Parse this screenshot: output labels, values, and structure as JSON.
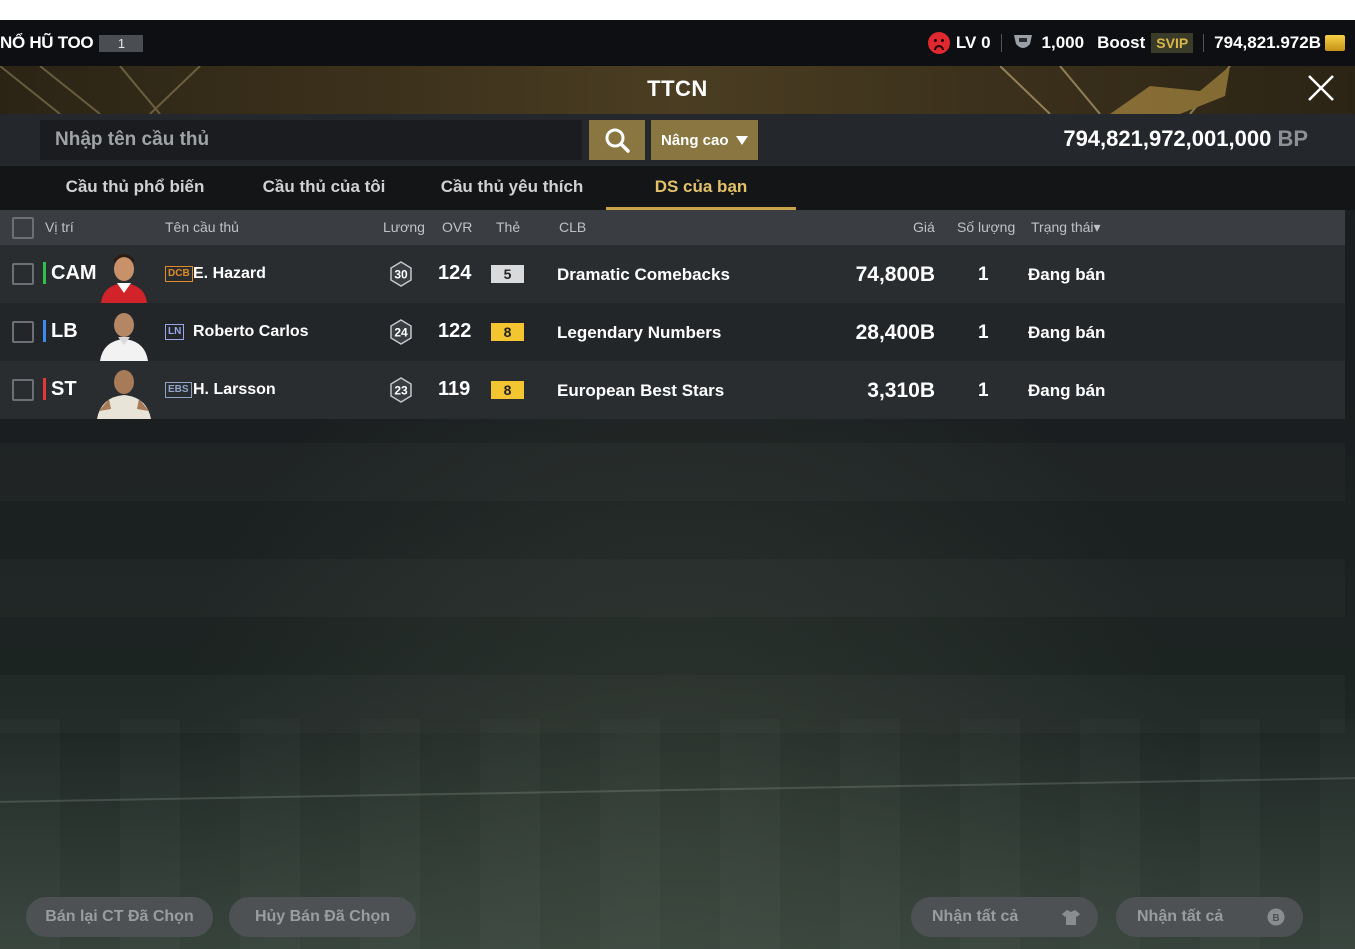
{
  "topbar": {
    "event_label": "NỔ HŨ TOO",
    "event_count": "1",
    "level": "LV 0",
    "trophy_value": "1,000",
    "boost_label": "Boost",
    "svip_label": "SVIP",
    "currency_value": "794,821.972B"
  },
  "header": {
    "title": "TTCN"
  },
  "search": {
    "placeholder": "Nhập tên cầu thủ",
    "advanced_label": "Nâng cao",
    "bp_amount": "794,821,972,001,000",
    "bp_unit": "BP"
  },
  "tabs": [
    {
      "label": "Cầu thủ phổ biến"
    },
    {
      "label": "Cầu thủ của tôi"
    },
    {
      "label": "Cầu thủ yêu thích"
    },
    {
      "label": "DS của bạn",
      "active": true
    }
  ],
  "columns": {
    "position": "Vị trí",
    "name": "Tên cầu thủ",
    "salary": "Lương",
    "ovr": "OVR",
    "card": "Thẻ",
    "club": "CLB",
    "price": "Giá",
    "quantity": "Số lượng",
    "status": "Trạng thái▾"
  },
  "rows": [
    {
      "position": "CAM",
      "position_color": "#2fc24a",
      "season": "DCB",
      "season_color": "#e08a2a",
      "name": "E. Hazard",
      "salary": "30",
      "ovr": "124",
      "card": "5",
      "card_color": "#d9dadc",
      "club": "Dramatic Comebacks",
      "price": "74,800B",
      "quantity": "1",
      "status": "Đang bán"
    },
    {
      "position": "LB",
      "position_color": "#3b8cf0",
      "season": "LN",
      "season_color": "#9aa6e8",
      "name": "Roberto Carlos",
      "salary": "24",
      "ovr": "122",
      "card": "8",
      "card_color": "#f2c531",
      "club": "Legendary Numbers",
      "price": "28,400B",
      "quantity": "1",
      "status": "Đang bán"
    },
    {
      "position": "ST",
      "position_color": "#e83535",
      "season": "EBS",
      "season_color": "#8fa4c8",
      "name": "H. Larsson",
      "salary": "23",
      "ovr": "119",
      "card": "8",
      "card_color": "#f2c531",
      "club": "European Best Stars",
      "price": "3,310B",
      "quantity": "1",
      "status": "Đang bán"
    }
  ],
  "bottom": {
    "resell_label": "Bán lại CT Đã Chọn",
    "cancel_label": "Hủy Bán Đã Chọn",
    "claim_all_players_label": "Nhận tất cả",
    "claim_all_bp_label": "Nhận tất cả"
  }
}
